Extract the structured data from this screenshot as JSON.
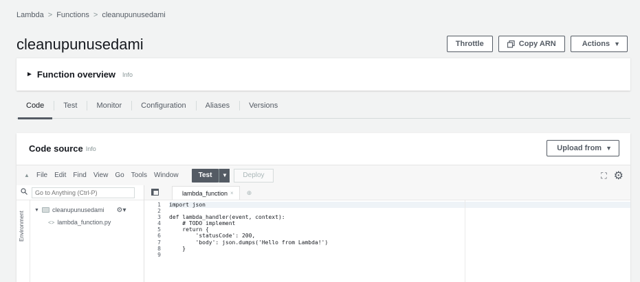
{
  "breadcrumb": {
    "items": [
      "Lambda",
      "Functions",
      "cleanupunusedami"
    ],
    "separator": ">"
  },
  "page": {
    "title": "cleanupunusedami"
  },
  "header_actions": {
    "throttle_label": "Throttle",
    "copy_arn_label": "Copy ARN",
    "actions_label": "Actions",
    "actions_caret": "▼",
    "copy_icon": "copy-icon"
  },
  "overview": {
    "toggle_glyph": "►",
    "title": "Function overview",
    "info": "Info"
  },
  "tabs": [
    {
      "label": "Code",
      "active": true
    },
    {
      "label": "Test",
      "active": false
    },
    {
      "label": "Monitor",
      "active": false
    },
    {
      "label": "Configuration",
      "active": false
    },
    {
      "label": "Aliases",
      "active": false
    },
    {
      "label": "Versions",
      "active": false
    }
  ],
  "code_source": {
    "title": "Code source",
    "info": "Info",
    "upload_label": "Upload from",
    "upload_caret": "▼"
  },
  "ide_toolbar": {
    "collapse_glyph": "▲",
    "menus": [
      "File",
      "Edit",
      "Find",
      "View",
      "Go",
      "Tools",
      "Window"
    ],
    "test_label": "Test",
    "test_caret": "▼",
    "deploy_label": "Deploy",
    "fullscreen_glyph": "⛶",
    "settings_glyph": "⚙"
  },
  "file_browser": {
    "search_placeholder": "Go to Anything (Ctrl-P)",
    "environment_label": "Environment",
    "folder_name": "cleanupunusedami",
    "file_name": "lambda_function.py",
    "folder_caret": "▼",
    "folder_gear": "⚙▾",
    "file_glyph": "<>"
  },
  "editor": {
    "tab_label": "lambda_function",
    "tab_close": "×",
    "add_tab": "⊕",
    "line_numbers": [
      "1",
      "2",
      "3",
      "4",
      "5",
      "6",
      "7",
      "8",
      "9"
    ],
    "lines": [
      "import json",
      "",
      "def lambda_handler(event, context):",
      "    # TODO implement",
      "    return {",
      "        'statusCode': 200,",
      "        'body': json.dumps('Hello from Lambda!')",
      "    }",
      ""
    ]
  },
  "colors": {
    "background": "#f2f3f3",
    "panel": "#ffffff",
    "text": "#16191f",
    "muted": "#545b64",
    "test_button": "#545b64"
  }
}
